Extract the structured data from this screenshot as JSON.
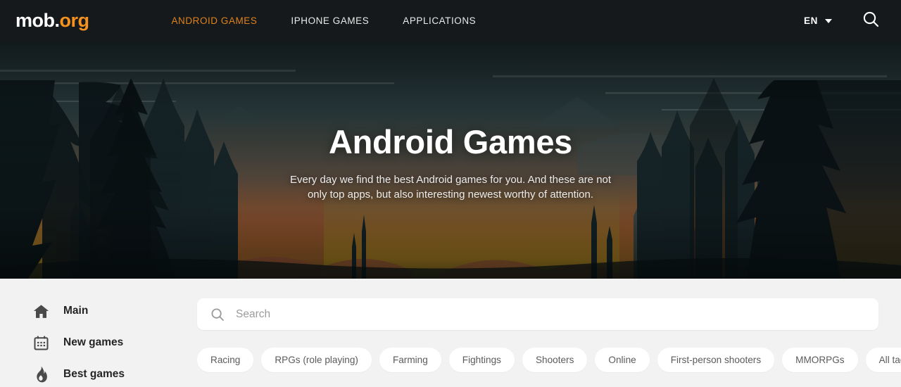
{
  "header": {
    "logo_white": "mob.",
    "logo_orange": "org",
    "nav": [
      {
        "label": "ANDROID GAMES",
        "active": true
      },
      {
        "label": "IPHONE GAMES",
        "active": false
      },
      {
        "label": "APPLICATIONS",
        "active": false
      }
    ],
    "language": "EN",
    "search_icon": "search-icon",
    "caret_icon": "chevron-down-icon",
    "bg_color": "#16191c",
    "accent_color": "#f5911e"
  },
  "hero": {
    "title": "Android Games",
    "subtitle": "Every day we find the best Android games for you. And these are not only top apps, but also interesting newest worthy of attention.",
    "subtitle_line1": "Every day we find the best Android games for you. And these are not",
    "subtitle_line2": "only top apps, but also interesting newest worthy of attention.",
    "artwork": "dark-forest-sunset-landscape"
  },
  "sidebar": {
    "items": [
      {
        "label": "Main",
        "icon": "home-icon"
      },
      {
        "label": "New games",
        "icon": "calendar-icon"
      },
      {
        "label": "Best games",
        "icon": "flame-icon"
      }
    ]
  },
  "search": {
    "placeholder": "Search",
    "value": "",
    "icon": "search-icon"
  },
  "tags": {
    "items": [
      {
        "label": "Racing"
      },
      {
        "label": "RPGs (role playing)"
      },
      {
        "label": "Farming"
      },
      {
        "label": "Fightings"
      },
      {
        "label": "Shooters"
      },
      {
        "label": "Online"
      },
      {
        "label": "First-person shooters"
      },
      {
        "label": "MMORPGs"
      }
    ],
    "all_tags_label": "All tags",
    "all_tags_icon": "chevron-right-icon"
  },
  "colors": {
    "page_bg": "#f2f2f2",
    "card_bg": "#ffffff",
    "text_dark": "#242424",
    "text_muted": "#5b5b5b"
  }
}
